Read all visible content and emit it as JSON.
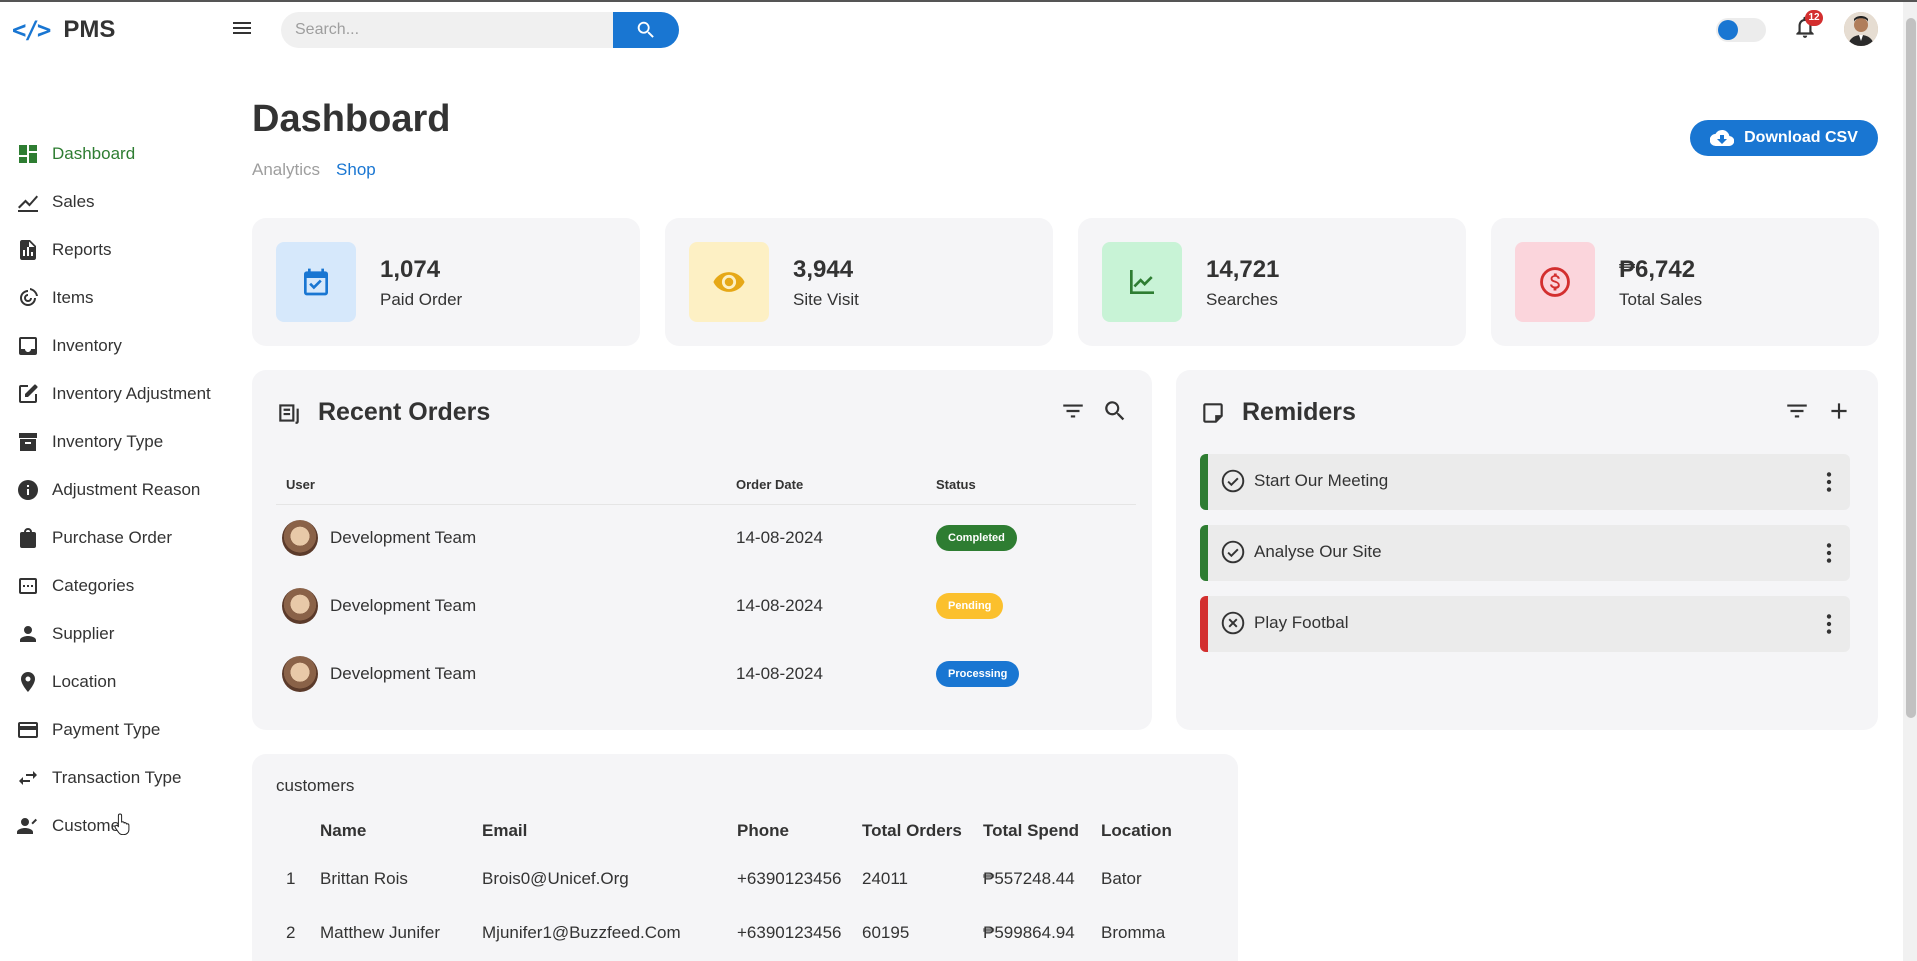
{
  "app": {
    "brand": "PMS",
    "brand_icon": "code-icon"
  },
  "search": {
    "placeholder": "Search..."
  },
  "notifications": {
    "count": "12"
  },
  "sidebar": {
    "items": [
      {
        "label": "Dashboard",
        "icon": "dashboard-icon",
        "active": true
      },
      {
        "label": "Sales",
        "icon": "chart-line-icon"
      },
      {
        "label": "Reports",
        "icon": "report-icon"
      },
      {
        "label": "Items",
        "icon": "items-icon"
      },
      {
        "label": "Inventory",
        "icon": "inbox-icon"
      },
      {
        "label": "Inventory Adjustment",
        "icon": "edit-icon"
      },
      {
        "label": "Inventory Type",
        "icon": "archive-icon"
      },
      {
        "label": "Adjustment Reason",
        "icon": "info-icon"
      },
      {
        "label": "Purchase Order",
        "icon": "shopping-bag-icon"
      },
      {
        "label": "Categories",
        "icon": "categories-icon"
      },
      {
        "label": "Supplier",
        "icon": "person-icon"
      },
      {
        "label": "Location",
        "icon": "location-pin-icon"
      },
      {
        "label": "Payment Type",
        "icon": "credit-card-icon"
      },
      {
        "label": "Transaction Type",
        "icon": "swap-icon"
      },
      {
        "label": "Customer",
        "icon": "person-check-icon"
      }
    ]
  },
  "header": {
    "title": "Dashboard",
    "tabs": [
      {
        "label": "Analytics",
        "active": false
      },
      {
        "label": "Shop",
        "active": true
      }
    ],
    "download_label": "Download CSV"
  },
  "stats": [
    {
      "value": "1,074",
      "label": "Paid Order",
      "icon": "calendar-check-icon",
      "bg": "#d6e8fb",
      "color": "#1976d2"
    },
    {
      "value": "3,944",
      "label": "Site Visit",
      "icon": "eye-icon",
      "bg": "#fdf0c4",
      "color": "#e6a817"
    },
    {
      "value": "14,721",
      "label": "Searches",
      "icon": "trend-icon",
      "bg": "#c8f3d6",
      "color": "#2e7d32"
    },
    {
      "value": "₱6,742",
      "label": "Total Sales",
      "icon": "dollar-circle-icon",
      "bg": "#fbd5dc",
      "color": "#d32f2f"
    }
  ],
  "recent_orders": {
    "title": "Recent Orders",
    "columns": [
      "User",
      "Order Date",
      "Status"
    ],
    "rows": [
      {
        "user": "Development Team",
        "date": "14-08-2024",
        "status": "Completed",
        "status_color": "#2e7d32"
      },
      {
        "user": "Development Team",
        "date": "14-08-2024",
        "status": "Pending",
        "status_color": "#fbc02d"
      },
      {
        "user": "Development Team",
        "date": "14-08-2024",
        "status": "Processing",
        "status_color": "#1976d2"
      }
    ]
  },
  "reminders": {
    "title": "Remiders",
    "items": [
      {
        "text": "Start Our Meeting",
        "state": "done",
        "color": "#2e7d32"
      },
      {
        "text": "Analyse Our Site",
        "state": "done",
        "color": "#2e7d32"
      },
      {
        "text": "Play Footbal",
        "state": "cancelled",
        "color": "#d32f2f"
      }
    ]
  },
  "customers": {
    "title": "customers",
    "columns": [
      "",
      "Name",
      "Email",
      "Phone",
      "Total Orders",
      "Total Spend",
      "Location"
    ],
    "rows": [
      [
        "1",
        "Brittan Rois",
        "Brois0@Unicef.Org",
        "+6390123456",
        "24011",
        "₱557248.44",
        "Bator"
      ],
      [
        "2",
        "Matthew Junifer",
        "Mjunifer1@Buzzfeed.Com",
        "+6390123456",
        "60195",
        "₱599864.94",
        "Bromma"
      ]
    ]
  }
}
